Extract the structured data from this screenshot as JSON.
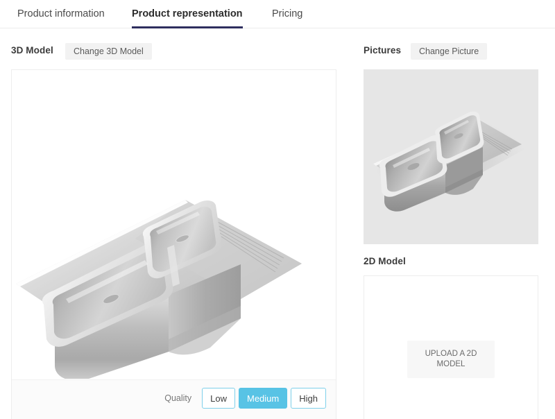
{
  "tabs": [
    {
      "label": "Product information",
      "active": false
    },
    {
      "label": "Product representation",
      "active": true
    },
    {
      "label": "Pricing",
      "active": false
    }
  ],
  "accent": {
    "tab_underline": "#2e2e5e",
    "selected_blue": "#58c3e5",
    "button_border_blue": "#7ed0ea",
    "gray_button_bg": "#f2f2f2",
    "panel_border": "#ededed",
    "picture_bg": "#e6e6e6"
  },
  "model3d": {
    "heading": "3D Model",
    "change_button": "Change 3D Model",
    "quality": {
      "label": "Quality",
      "options": [
        "Low",
        "Medium",
        "High"
      ],
      "selected": "Medium"
    },
    "viewer_alt": "stainless-steel double bowl kitchen sink with right drainboard"
  },
  "pictures": {
    "heading": "Pictures",
    "change_button": "Change Picture",
    "thumbnail_alt": "stainless-steel double bowl kitchen sink with right drainboard"
  },
  "model2d": {
    "heading": "2D Model",
    "upload_button": "UPLOAD A 2D MODEL"
  }
}
